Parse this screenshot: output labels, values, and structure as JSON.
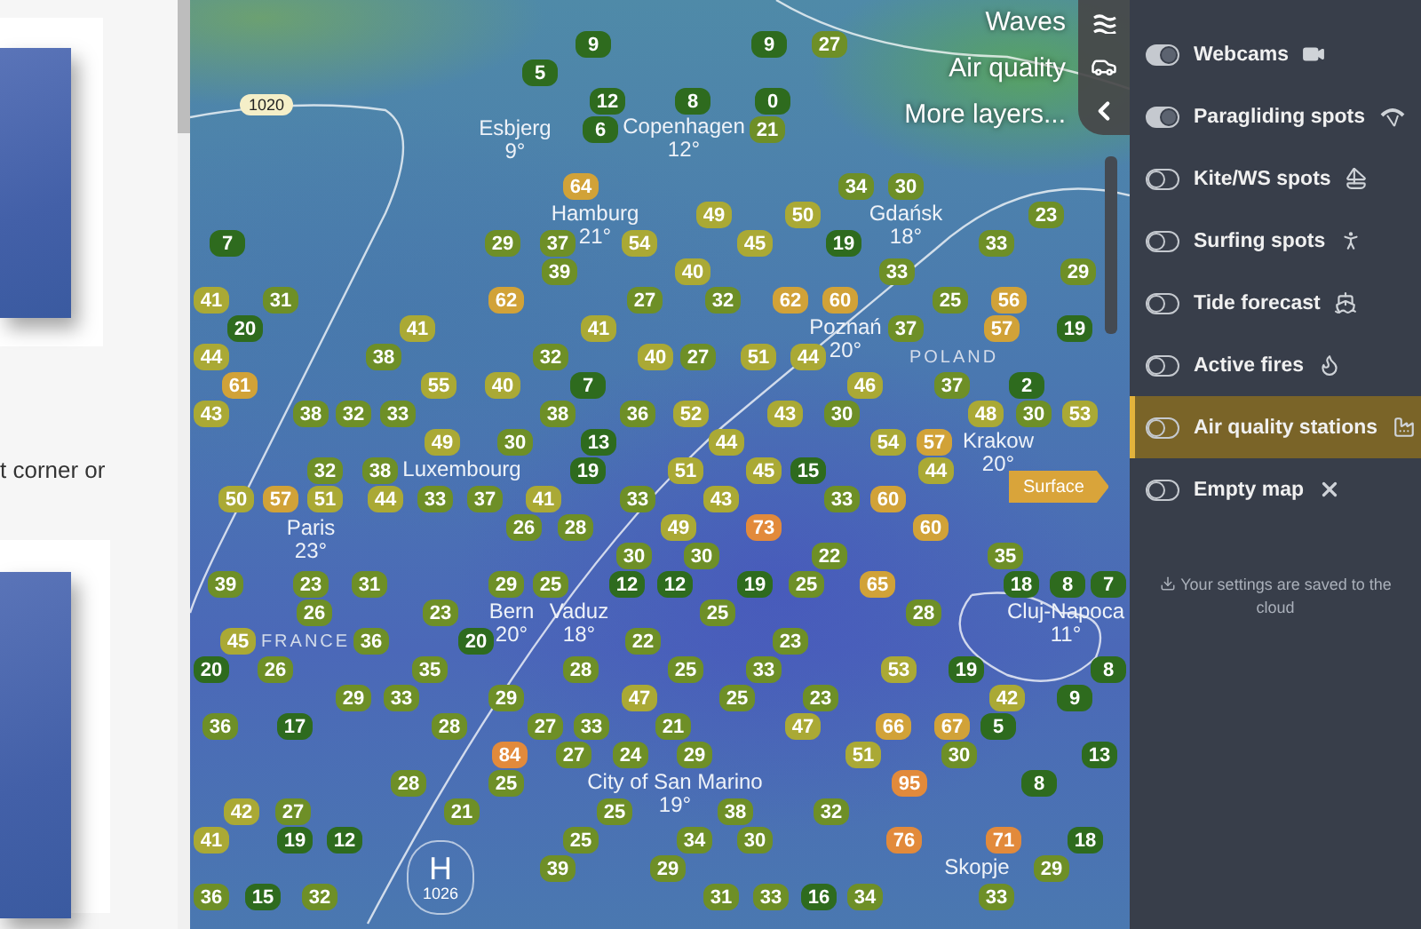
{
  "article": {
    "text": "t corner or"
  },
  "layers": [
    {
      "label": "Waves",
      "kind": "waves"
    },
    {
      "label": "Air quality",
      "kind": "car"
    },
    {
      "label": "More layers...",
      "kind": "back"
    }
  ],
  "map": {
    "isobars": [
      "1020"
    ],
    "pressure_center": {
      "letter": "H",
      "value": "1026"
    },
    "surface_tag": "Surface",
    "countries": [
      "POLAND",
      "FRANCE"
    ],
    "cities": [
      {
        "name": "Esbjerg",
        "temp": "9°"
      },
      {
        "name": "Copenhagen",
        "temp": "12°"
      },
      {
        "name": "Hamburg",
        "temp": "21°"
      },
      {
        "name": "Gdańsk",
        "temp": "18°"
      },
      {
        "name": "Poznań",
        "temp": "20°"
      },
      {
        "name": "Krakow",
        "temp": "20°"
      },
      {
        "name": "Luxembourg"
      },
      {
        "name": "Paris",
        "temp": "23°"
      },
      {
        "name": "Bern",
        "temp": "20°"
      },
      {
        "name": "Vaduz",
        "temp": "18°"
      },
      {
        "name": "Cluj-Napoca",
        "temp": "11°"
      },
      {
        "name": "City of San Marino",
        "temp": "19°"
      },
      {
        "name": "Skopje"
      }
    ],
    "stations": [
      {
        "value": "9",
        "color": "#2e6b1e"
      },
      {
        "value": "9",
        "color": "#2e6b1e"
      },
      {
        "value": "27",
        "color": "#6e8f27"
      },
      {
        "value": "5",
        "color": "#2e6b1e"
      },
      {
        "value": "12",
        "color": "#2e6b1e"
      },
      {
        "value": "8",
        "color": "#2e6b1e"
      },
      {
        "value": "0",
        "color": "#2e6b1e"
      },
      {
        "value": "6",
        "color": "#2e6b1e"
      },
      {
        "value": "21",
        "color": "#6e8f27"
      },
      {
        "value": "64",
        "color": "#d1a238"
      },
      {
        "value": "34",
        "color": "#6e8f27"
      },
      {
        "value": "30",
        "color": "#6e8f27"
      },
      {
        "value": "49",
        "color": "#aaa935"
      },
      {
        "value": "50",
        "color": "#aaa935"
      },
      {
        "value": "23",
        "color": "#6e8f27"
      },
      {
        "value": "7",
        "color": "#2e6b1e"
      },
      {
        "value": "29",
        "color": "#6e8f27"
      },
      {
        "value": "37",
        "color": "#6e8f27"
      },
      {
        "value": "54",
        "color": "#aaa935"
      },
      {
        "value": "45",
        "color": "#aaa935"
      },
      {
        "value": "19",
        "color": "#2e6b1e"
      },
      {
        "value": "33",
        "color": "#6e8f27"
      },
      {
        "value": "39",
        "color": "#6e8f27"
      },
      {
        "value": "40",
        "color": "#aaa935"
      },
      {
        "value": "33",
        "color": "#6e8f27"
      },
      {
        "value": "29",
        "color": "#6e8f27"
      },
      {
        "value": "41",
        "color": "#aaa935"
      },
      {
        "value": "31",
        "color": "#6e8f27"
      },
      {
        "value": "62",
        "color": "#d1a238"
      },
      {
        "value": "27",
        "color": "#6e8f27"
      },
      {
        "value": "32",
        "color": "#6e8f27"
      },
      {
        "value": "62",
        "color": "#d1a238"
      },
      {
        "value": "60",
        "color": "#d1a238"
      },
      {
        "value": "25",
        "color": "#6e8f27"
      },
      {
        "value": "56",
        "color": "#d1a238"
      },
      {
        "value": "20",
        "color": "#2e6b1e"
      },
      {
        "value": "41",
        "color": "#aaa935"
      },
      {
        "value": "41",
        "color": "#aaa935"
      },
      {
        "value": "37",
        "color": "#6e8f27"
      },
      {
        "value": "57",
        "color": "#d1a238"
      },
      {
        "value": "19",
        "color": "#2e6b1e"
      },
      {
        "value": "44",
        "color": "#aaa935"
      },
      {
        "value": "38",
        "color": "#6e8f27"
      },
      {
        "value": "32",
        "color": "#6e8f27"
      },
      {
        "value": "40",
        "color": "#aaa935"
      },
      {
        "value": "27",
        "color": "#6e8f27"
      },
      {
        "value": "51",
        "color": "#aaa935"
      },
      {
        "value": "44",
        "color": "#aaa935"
      },
      {
        "value": "61",
        "color": "#d1a238"
      },
      {
        "value": "55",
        "color": "#aaa935"
      },
      {
        "value": "40",
        "color": "#aaa935"
      },
      {
        "value": "7",
        "color": "#2e6b1e"
      },
      {
        "value": "46",
        "color": "#aaa935"
      },
      {
        "value": "37",
        "color": "#6e8f27"
      },
      {
        "value": "2",
        "color": "#2e6b1e"
      },
      {
        "value": "43",
        "color": "#aaa935"
      },
      {
        "value": "38",
        "color": "#6e8f27"
      },
      {
        "value": "32",
        "color": "#6e8f27"
      },
      {
        "value": "33",
        "color": "#6e8f27"
      },
      {
        "value": "38",
        "color": "#6e8f27"
      },
      {
        "value": "36",
        "color": "#6e8f27"
      },
      {
        "value": "52",
        "color": "#aaa935"
      },
      {
        "value": "43",
        "color": "#aaa935"
      },
      {
        "value": "30",
        "color": "#6e8f27"
      },
      {
        "value": "48",
        "color": "#aaa935"
      },
      {
        "value": "30",
        "color": "#6e8f27"
      },
      {
        "value": "53",
        "color": "#aaa935"
      },
      {
        "value": "49",
        "color": "#aaa935"
      },
      {
        "value": "30",
        "color": "#6e8f27"
      },
      {
        "value": "13",
        "color": "#2e6b1e"
      },
      {
        "value": "44",
        "color": "#aaa935"
      },
      {
        "value": "54",
        "color": "#aaa935"
      },
      {
        "value": "57",
        "color": "#d1a238"
      },
      {
        "value": "32",
        "color": "#6e8f27"
      },
      {
        "value": "38",
        "color": "#6e8f27"
      },
      {
        "value": "19",
        "color": "#2e6b1e"
      },
      {
        "value": "51",
        "color": "#aaa935"
      },
      {
        "value": "45",
        "color": "#aaa935"
      },
      {
        "value": "15",
        "color": "#2e6b1e"
      },
      {
        "value": "44",
        "color": "#aaa935"
      },
      {
        "value": "50",
        "color": "#aaa935"
      },
      {
        "value": "57",
        "color": "#d1a238"
      },
      {
        "value": "51",
        "color": "#aaa935"
      },
      {
        "value": "44",
        "color": "#aaa935"
      },
      {
        "value": "33",
        "color": "#6e8f27"
      },
      {
        "value": "37",
        "color": "#6e8f27"
      },
      {
        "value": "41",
        "color": "#aaa935"
      },
      {
        "value": "33",
        "color": "#6e8f27"
      },
      {
        "value": "43",
        "color": "#aaa935"
      },
      {
        "value": "33",
        "color": "#6e8f27"
      },
      {
        "value": "60",
        "color": "#d1a238"
      },
      {
        "value": "26",
        "color": "#6e8f27"
      },
      {
        "value": "28",
        "color": "#6e8f27"
      },
      {
        "value": "49",
        "color": "#aaa935"
      },
      {
        "value": "73",
        "color": "#e28a3b"
      },
      {
        "value": "60",
        "color": "#d1a238"
      },
      {
        "value": "30",
        "color": "#6e8f27"
      },
      {
        "value": "30",
        "color": "#6e8f27"
      },
      {
        "value": "22",
        "color": "#6e8f27"
      },
      {
        "value": "35",
        "color": "#6e8f27"
      },
      {
        "value": "39",
        "color": "#6e8f27"
      },
      {
        "value": "23",
        "color": "#6e8f27"
      },
      {
        "value": "31",
        "color": "#6e8f27"
      },
      {
        "value": "29",
        "color": "#6e8f27"
      },
      {
        "value": "25",
        "color": "#6e8f27"
      },
      {
        "value": "12",
        "color": "#2e6b1e"
      },
      {
        "value": "12",
        "color": "#2e6b1e"
      },
      {
        "value": "19",
        "color": "#2e6b1e"
      },
      {
        "value": "25",
        "color": "#6e8f27"
      },
      {
        "value": "65",
        "color": "#d1a238"
      },
      {
        "value": "18",
        "color": "#2e6b1e"
      },
      {
        "value": "8",
        "color": "#2e6b1e"
      },
      {
        "value": "7",
        "color": "#2e6b1e"
      },
      {
        "value": "26",
        "color": "#6e8f27"
      },
      {
        "value": "23",
        "color": "#6e8f27"
      },
      {
        "value": "25",
        "color": "#6e8f27"
      },
      {
        "value": "28",
        "color": "#6e8f27"
      },
      {
        "value": "45",
        "color": "#aaa935"
      },
      {
        "value": "36",
        "color": "#6e8f27"
      },
      {
        "value": "20",
        "color": "#2e6b1e"
      },
      {
        "value": "22",
        "color": "#6e8f27"
      },
      {
        "value": "23",
        "color": "#6e8f27"
      },
      {
        "value": "20",
        "color": "#2e6b1e"
      },
      {
        "value": "26",
        "color": "#6e8f27"
      },
      {
        "value": "35",
        "color": "#6e8f27"
      },
      {
        "value": "28",
        "color": "#6e8f27"
      },
      {
        "value": "25",
        "color": "#6e8f27"
      },
      {
        "value": "33",
        "color": "#6e8f27"
      },
      {
        "value": "53",
        "color": "#aaa935"
      },
      {
        "value": "19",
        "color": "#2e6b1e"
      },
      {
        "value": "8",
        "color": "#2e6b1e"
      },
      {
        "value": "29",
        "color": "#6e8f27"
      },
      {
        "value": "33",
        "color": "#6e8f27"
      },
      {
        "value": "29",
        "color": "#6e8f27"
      },
      {
        "value": "47",
        "color": "#aaa935"
      },
      {
        "value": "25",
        "color": "#6e8f27"
      },
      {
        "value": "23",
        "color": "#6e8f27"
      },
      {
        "value": "42",
        "color": "#aaa935"
      },
      {
        "value": "9",
        "color": "#2e6b1e"
      },
      {
        "value": "36",
        "color": "#6e8f27"
      },
      {
        "value": "17",
        "color": "#2e6b1e"
      },
      {
        "value": "28",
        "color": "#6e8f27"
      },
      {
        "value": "27",
        "color": "#6e8f27"
      },
      {
        "value": "33",
        "color": "#6e8f27"
      },
      {
        "value": "21",
        "color": "#6e8f27"
      },
      {
        "value": "47",
        "color": "#aaa935"
      },
      {
        "value": "66",
        "color": "#d1a238"
      },
      {
        "value": "67",
        "color": "#d1a238"
      },
      {
        "value": "5",
        "color": "#2e6b1e"
      },
      {
        "value": "84",
        "color": "#e28a3b"
      },
      {
        "value": "27",
        "color": "#6e8f27"
      },
      {
        "value": "24",
        "color": "#6e8f27"
      },
      {
        "value": "29",
        "color": "#6e8f27"
      },
      {
        "value": "51",
        "color": "#aaa935"
      },
      {
        "value": "30",
        "color": "#6e8f27"
      },
      {
        "value": "13",
        "color": "#2e6b1e"
      },
      {
        "value": "28",
        "color": "#6e8f27"
      },
      {
        "value": "25",
        "color": "#6e8f27"
      },
      {
        "value": "95",
        "color": "#e28a3b"
      },
      {
        "value": "8",
        "color": "#2e6b1e"
      },
      {
        "value": "42",
        "color": "#aaa935"
      },
      {
        "value": "27",
        "color": "#6e8f27"
      },
      {
        "value": "21",
        "color": "#6e8f27"
      },
      {
        "value": "25",
        "color": "#6e8f27"
      },
      {
        "value": "38",
        "color": "#6e8f27"
      },
      {
        "value": "32",
        "color": "#6e8f27"
      },
      {
        "value": "41",
        "color": "#aaa935"
      },
      {
        "value": "19",
        "color": "#2e6b1e"
      },
      {
        "value": "12",
        "color": "#2e6b1e"
      },
      {
        "value": "25",
        "color": "#6e8f27"
      },
      {
        "value": "34",
        "color": "#6e8f27"
      },
      {
        "value": "30",
        "color": "#6e8f27"
      },
      {
        "value": "76",
        "color": "#e28a3b"
      },
      {
        "value": "71",
        "color": "#e28a3b"
      },
      {
        "value": "18",
        "color": "#2e6b1e"
      },
      {
        "value": "39",
        "color": "#6e8f27"
      },
      {
        "value": "29",
        "color": "#6e8f27"
      },
      {
        "value": "29",
        "color": "#6e8f27"
      },
      {
        "value": "36",
        "color": "#6e8f27"
      },
      {
        "value": "15",
        "color": "#2e6b1e"
      },
      {
        "value": "32",
        "color": "#6e8f27"
      },
      {
        "value": "31",
        "color": "#6e8f27"
      },
      {
        "value": "33",
        "color": "#6e8f27"
      },
      {
        "value": "16",
        "color": "#2e6b1e"
      },
      {
        "value": "34",
        "color": "#6e8f27"
      },
      {
        "value": "33",
        "color": "#6e8f27"
      }
    ]
  },
  "overlays": [
    {
      "label": "Webcams",
      "kind": "webcam",
      "on": true,
      "selected": false
    },
    {
      "label": "Paragliding spots",
      "kind": "paragliding",
      "on": true,
      "selected": false
    },
    {
      "label": "Kite/WS spots",
      "kind": "kite",
      "on": false,
      "selected": false
    },
    {
      "label": "Surfing spots",
      "kind": "surf",
      "on": false,
      "selected": false
    },
    {
      "label": "Tide forecast",
      "kind": "tide",
      "on": false,
      "selected": false
    },
    {
      "label": "Active fires",
      "kind": "fire",
      "on": false,
      "selected": false
    },
    {
      "label": "Air quality stations",
      "kind": "air",
      "on": false,
      "selected": true
    },
    {
      "label": "Empty map",
      "kind": "empty",
      "on": false,
      "selected": false
    }
  ],
  "settings_note": "Your settings are saved to the cloud"
}
